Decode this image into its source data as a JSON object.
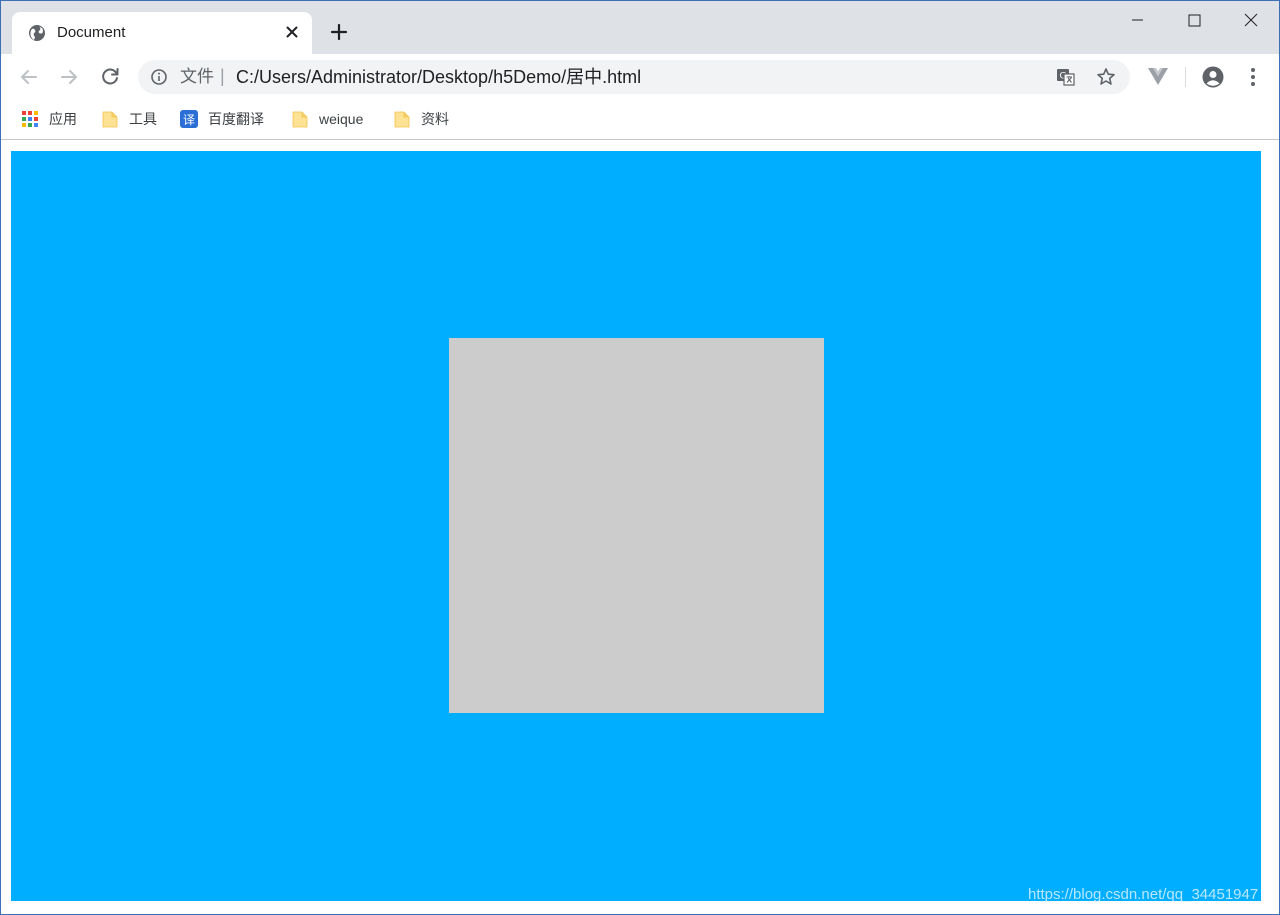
{
  "tab": {
    "title": "Document",
    "favicon": "globe-icon"
  },
  "toolbar": {
    "security_label": "文件",
    "separator": "|",
    "url": "C:/Users/Administrator/Desktop/h5Demo/居中.html"
  },
  "bookmarks": {
    "items": [
      {
        "label": "应用",
        "icon": "apps-grid-icon"
      },
      {
        "label": "工具",
        "icon": "folder-icon"
      },
      {
        "label": "百度翻译",
        "icon": "baidu-translate-icon"
      },
      {
        "label": "weique",
        "icon": "folder-icon"
      },
      {
        "label": "资料",
        "icon": "folder-icon"
      }
    ]
  },
  "page": {
    "outer_color": "#00aeff",
    "inner_color": "#cccccc",
    "watermark": "https://blog.csdn.net/qq_34451947"
  }
}
